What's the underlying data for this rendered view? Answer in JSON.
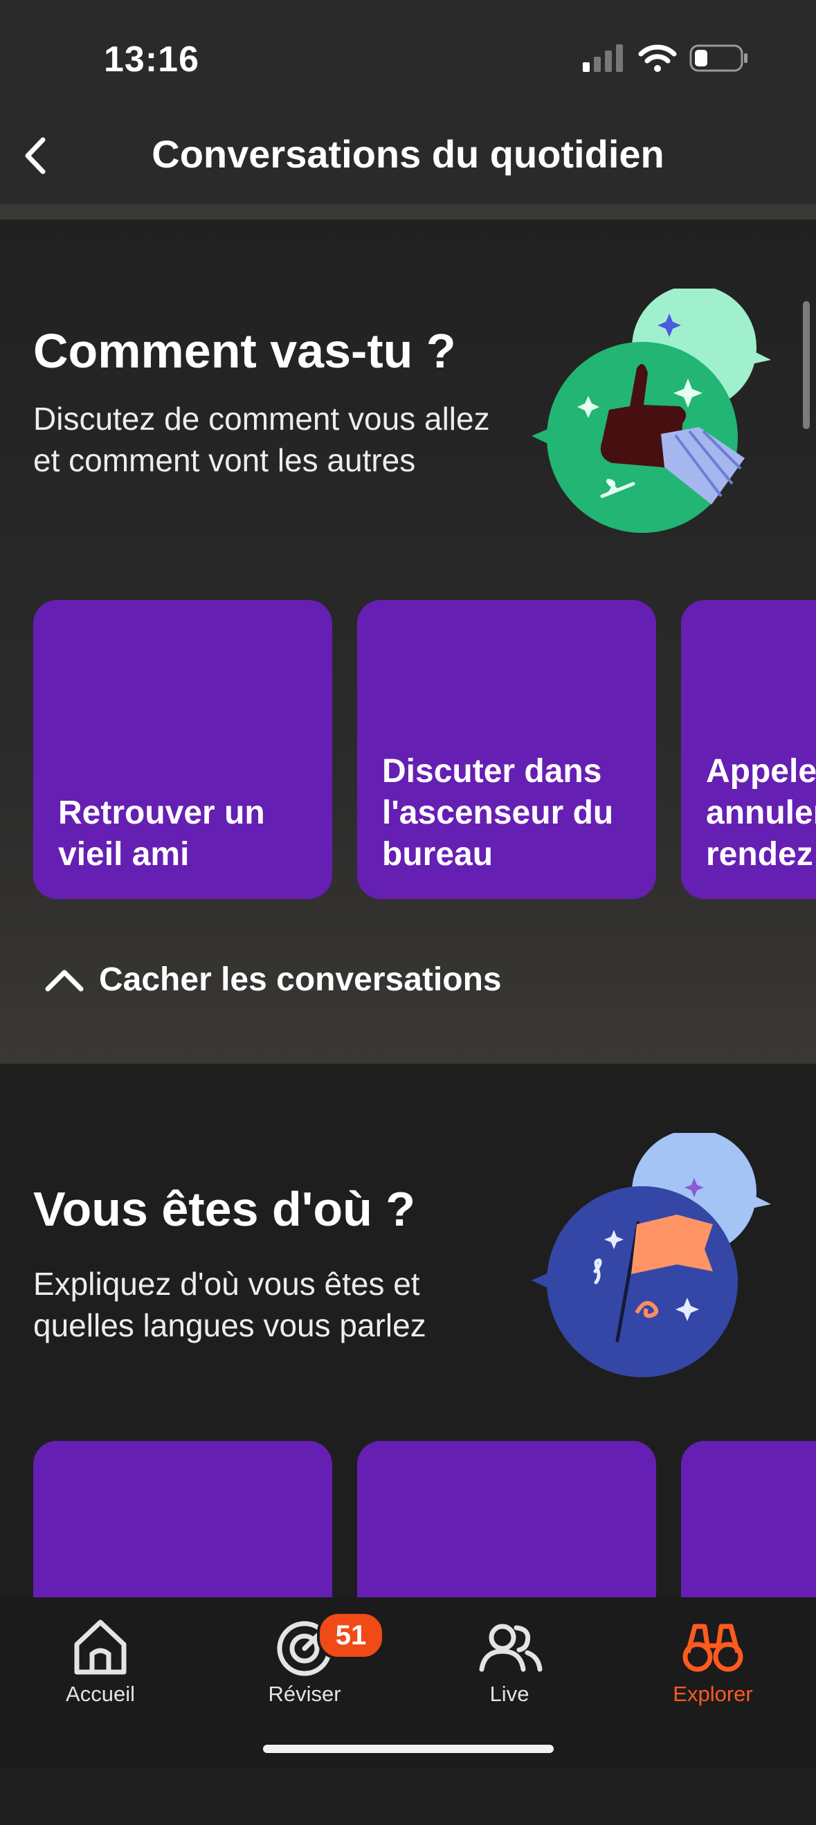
{
  "status_bar": {
    "time": "13:16"
  },
  "header": {
    "title": "Conversations du quotidien"
  },
  "sections": [
    {
      "title": "Comment vas-tu ?",
      "description": "Discutez de comment vous allez et comment vont les autres",
      "cards": [
        {
          "label": "Retrouver un\nvieil ami"
        },
        {
          "label": "Discuter dans\nl'ascenseur du\nbureau"
        },
        {
          "label": "Appeler\nannuler\nrendez"
        }
      ],
      "toggle_label": "Cacher les conversations"
    },
    {
      "title": "Vous êtes d'où ?",
      "description": "Expliquez d'où vous êtes et quelles langues vous parlez",
      "cards": [
        {
          "label": ""
        },
        {
          "label": ""
        },
        {
          "label": ""
        }
      ]
    }
  ],
  "tab_bar": {
    "tabs": [
      {
        "label": "Accueil",
        "icon": "home-icon"
      },
      {
        "label": "Réviser",
        "icon": "target-icon",
        "badge": "51"
      },
      {
        "label": "Live",
        "icon": "people-icon"
      },
      {
        "label": "Explorer",
        "icon": "binoculars-icon",
        "active": true
      }
    ]
  },
  "colors": {
    "card": "#661fb3",
    "accent": "#ff5a1f",
    "badge": "#f04a16"
  }
}
